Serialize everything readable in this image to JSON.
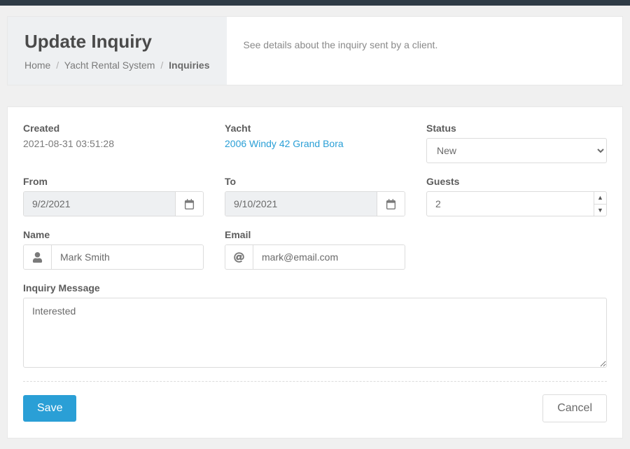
{
  "header": {
    "title": "Update Inquiry",
    "subtitle": "See details about the inquiry sent by a client.",
    "breadcrumbs": {
      "home": "Home",
      "system": "Yacht Rental System",
      "current": "Inquiries"
    }
  },
  "labels": {
    "created": "Created",
    "yacht": "Yacht",
    "status": "Status",
    "from": "From",
    "to": "To",
    "guests": "Guests",
    "name": "Name",
    "email": "Email",
    "message": "Inquiry Message"
  },
  "values": {
    "created": "2021-08-31 03:51:28",
    "yacht": "2006 Windy 42 Grand Bora",
    "status": "New",
    "from": "9/2/2021",
    "to": "9/10/2021",
    "guests": "2",
    "name": "Mark Smith",
    "email": "mark@email.com",
    "message": "Interested"
  },
  "actions": {
    "save": "Save",
    "cancel": "Cancel"
  }
}
